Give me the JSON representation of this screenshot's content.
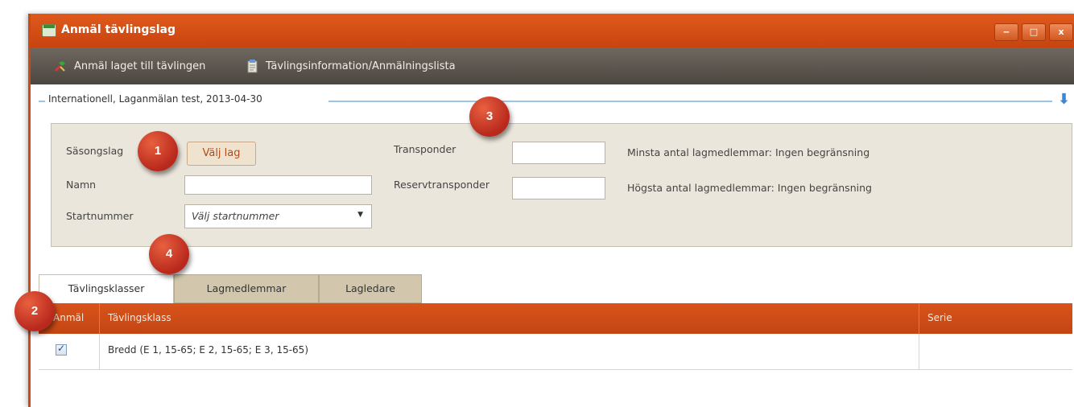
{
  "window": {
    "title": "Anmäl tävlingslag",
    "controls": {
      "minimize": "‒",
      "maximize": "□",
      "close": "x"
    }
  },
  "toolbar": {
    "items": [
      {
        "label": "Anmäl laget till tävlingen",
        "icon": "register-icon"
      },
      {
        "label": "Tävlingsinformation/Anmälningslista",
        "icon": "document-icon"
      }
    ]
  },
  "section": {
    "title": "Internationell, Laganmälan test, 2013-04-30"
  },
  "form": {
    "season_team_label": "Säsongslag",
    "choose_team_button": "Välj lag",
    "name_label": "Namn",
    "name_value": "",
    "start_number_label": "Startnummer",
    "start_number_placeholder": "Välj startnummer",
    "transponder_label": "Transponder",
    "transponder_value": "",
    "reserve_transponder_label": "Reservtransponder",
    "reserve_transponder_value": "",
    "min_members": "Minsta antal lagmedlemmar: Ingen begränsning",
    "max_members": "Högsta antal lagmedlemmar: Ingen begränsning"
  },
  "badges": [
    "1",
    "2",
    "3",
    "4"
  ],
  "tabs": [
    {
      "label": "Tävlingsklasser",
      "active": true
    },
    {
      "label": "Lagmedlemmar",
      "active": false
    },
    {
      "label": "Lagledare",
      "active": false
    }
  ],
  "grid": {
    "columns": [
      "Anmäl",
      "Tävlingsklass",
      "Serie"
    ],
    "rows": [
      {
        "checked": true,
        "class": "Bredd (E 1, 15-65; E 2, 15-65; E 3, 15-65)",
        "serie": ""
      }
    ]
  },
  "colors": {
    "titlebar": "#d24e15",
    "toolbar": "#5c564f",
    "badge": "#c0392b",
    "section_rule": "#9cc6e8"
  }
}
